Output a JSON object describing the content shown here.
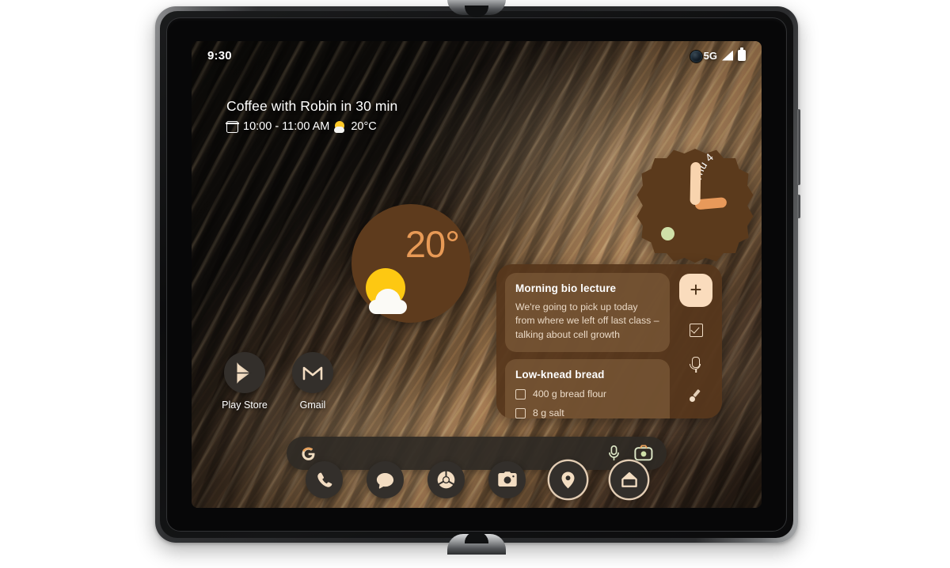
{
  "device": {
    "name": "Pixel Fold inner display",
    "camera_icon": "front-camera-punch-hole"
  },
  "status_bar": {
    "time": "9:30",
    "network": "5G",
    "signal_icon": "signal-bars-icon",
    "battery_icon": "battery-full-icon"
  },
  "at_a_glance": {
    "title": "Coffee with Robin in 30 min",
    "calendar_icon": "calendar-icon",
    "time_range": "10:00 - 11:00 AM",
    "weather_icon": "sun-behind-cloud-icon",
    "temperature": "20°C"
  },
  "clock_widget": {
    "day_label": "Thu 4",
    "hour_hand_color": "#e8995a",
    "minute_hand_color": "#f8d4ae",
    "dot_color": "#cfe0a8",
    "background_color": "#5b3a1c"
  },
  "weather_widget": {
    "temperature": "20°",
    "icon": "sun-behind-cloud-icon",
    "accent_color": "#e89a56",
    "background_color": "#5e3b1d"
  },
  "keep_widget": {
    "notes": [
      {
        "title": "Morning bio lecture",
        "body": "We're going to pick up today from where we left off last class – talking about cell growth",
        "checklist": []
      },
      {
        "title": "Low-knead bread",
        "body": "",
        "checklist": [
          "400 g bread flour",
          "8 g salt"
        ]
      }
    ],
    "actions": [
      {
        "label": "+",
        "name": "new-note-button",
        "icon": "plus-icon"
      },
      {
        "label": "",
        "name": "new-list-button",
        "icon": "checkbox-icon"
      },
      {
        "label": "",
        "name": "new-voice-note-button",
        "icon": "microphone-icon"
      },
      {
        "label": "",
        "name": "new-drawing-button",
        "icon": "brush-icon"
      }
    ]
  },
  "apps": [
    {
      "label": "Play Store",
      "icon": "play-store-icon"
    },
    {
      "label": "Gmail",
      "icon": "gmail-icon"
    }
  ],
  "search": {
    "placeholder": "",
    "value": "",
    "google_icon": "google-g-icon",
    "mic_icon": "microphone-icon",
    "lens_icon": "google-lens-camera-icon"
  },
  "dock": [
    {
      "name": "phone",
      "icon": "phone-icon",
      "ring": false
    },
    {
      "name": "messages",
      "icon": "message-bubble-icon",
      "ring": false
    },
    {
      "name": "chrome",
      "icon": "chrome-icon",
      "ring": false
    },
    {
      "name": "camera",
      "icon": "camera-icon",
      "ring": false
    },
    {
      "name": "maps",
      "icon": "map-pin-icon",
      "ring": true
    },
    {
      "name": "home",
      "icon": "home-icon",
      "ring": true
    }
  ],
  "theme": {
    "icon_fill": "#f3ddc2",
    "icon_bg": "#332f2b",
    "brown": "#56361c"
  }
}
